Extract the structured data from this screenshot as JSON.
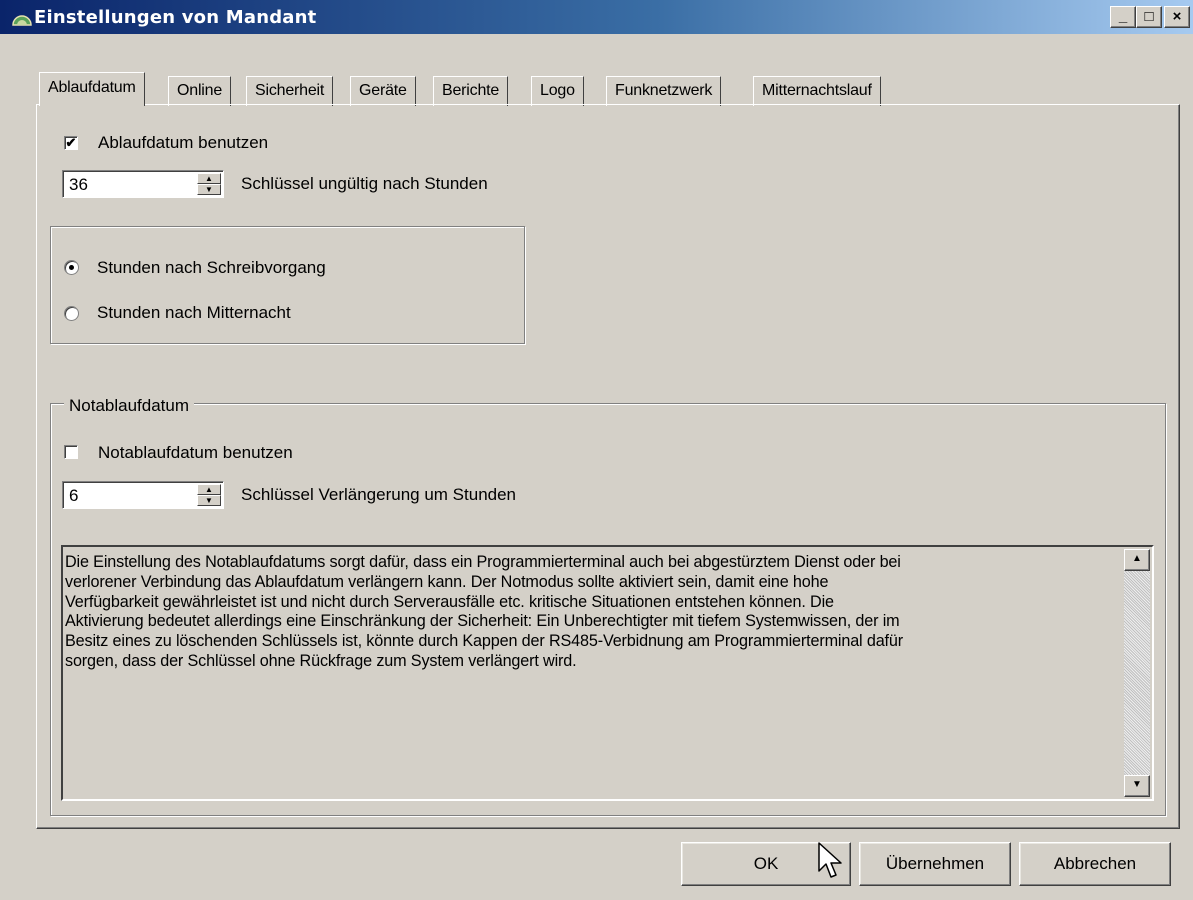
{
  "window": {
    "title": "Einstellungen von Mandant",
    "icon": "app-icon",
    "controls": {
      "minimize": "_",
      "maximize": "□",
      "close": "×"
    }
  },
  "tabs": [
    {
      "label": "Ablaufdatum",
      "active": true
    },
    {
      "label": "Online"
    },
    {
      "label": "Sicherheit"
    },
    {
      "label": "Geräte"
    },
    {
      "label": "Berichte"
    },
    {
      "label": "Logo"
    },
    {
      "label": "Funknetzwerk"
    },
    {
      "label": "Mitternachtslauf"
    }
  ],
  "expiry": {
    "use_checkbox": {
      "label": "Ablaufdatum benutzen",
      "checked": true
    },
    "hours": {
      "value": "36",
      "label": "Schlüssel ungültig nach Stunden"
    },
    "radios": [
      {
        "label": "Stunden nach Schreibvorgang",
        "selected": true
      },
      {
        "label": "Stunden nach Mitternacht",
        "selected": false
      }
    ]
  },
  "emergency": {
    "group_label": "Notablaufdatum",
    "use_checkbox": {
      "label": "Notablaufdatum benutzen",
      "checked": false
    },
    "hours": {
      "value": "6",
      "label": "Schlüssel Verlängerung um Stunden"
    },
    "description_lines": [
      "Die Einstellung des Notablaufdatums sorgt dafür, dass ein Programmierterminal auch bei abgestürztem Dienst oder bei",
      "verlorener Verbindung das Ablaufdatum verlängern kann. Der Notmodus sollte aktiviert sein, damit eine hohe",
      "Verfügbarkeit gewährleistet ist und nicht durch Serverausfälle etc. kritische Situationen entstehen können. Die",
      "Aktivierung bedeutet allerdings eine Einschränkung der Sicherheit: Ein Unberechtigter mit tiefem Systemwissen, der im",
      "Besitz eines zu löschenden Schlüssels ist, könnte durch Kappen der RS485-Verbidnung am Programmierterminal dafür",
      "sorgen, dass der Schlüssel ohne Rückfrage zum System verlängert wird."
    ]
  },
  "buttons": {
    "ok": "OK",
    "apply": "Übernehmen",
    "cancel": "Abbrechen"
  },
  "glyphs": {
    "check": "✔",
    "spin_up": "▲",
    "spin_down": "▼",
    "scroll_up": "▲",
    "scroll_down": "▼"
  }
}
